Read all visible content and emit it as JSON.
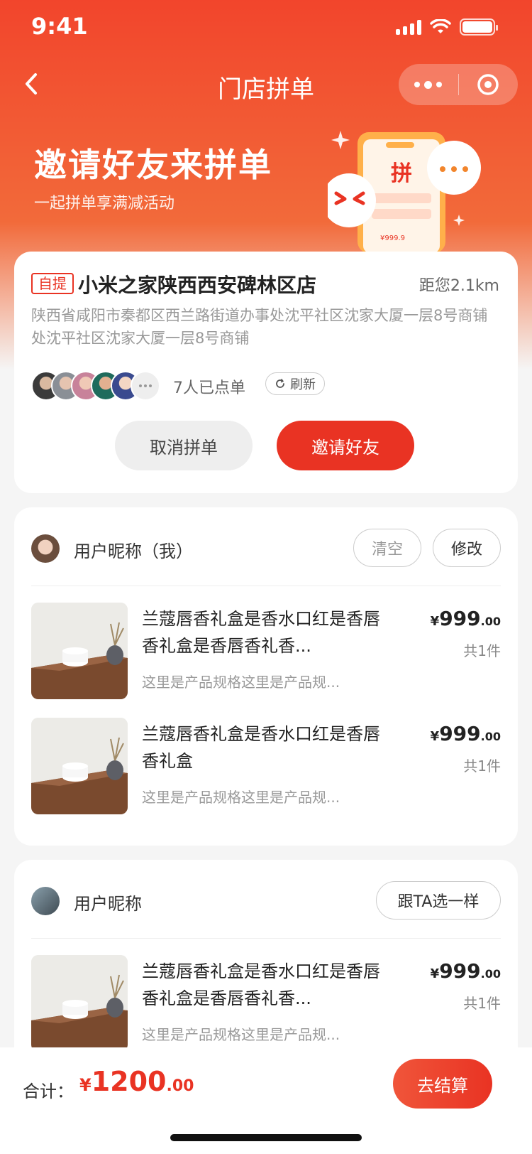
{
  "status_bar": {
    "time": "9:41"
  },
  "nav": {
    "title": "门店拼单"
  },
  "hero": {
    "title": "邀请好友来拼单",
    "subtitle": "一起拼单享满减活动",
    "badge_char": "拼",
    "badge_price": "¥999.9"
  },
  "store": {
    "tag": "自提",
    "name": "小米之家陕西西安碑林区店",
    "distance": "距您2.1km",
    "address": "陕西省咸阳市秦都区西兰路街道办事处沈平社区沈家大厦一层8号商铺处沈平社区沈家大厦一层8号商铺",
    "order_count": "7人已点单",
    "refresh_label": "刷新",
    "cancel_label": "取消拼单",
    "invite_label": "邀请好友"
  },
  "sections": [
    {
      "user_name": "用户昵称（我）",
      "clear_label": "清空",
      "edit_label": "修改",
      "products": [
        {
          "title": "兰蔻唇香礼盒是香水口红是香唇香礼盒是香唇香礼香...",
          "spec": "这里是产品规格这里是产品规...",
          "price_currency": "¥",
          "price_int": "999",
          "price_dec": ".00",
          "qty": "共1件"
        },
        {
          "title": "兰蔻唇香礼盒是香水口红是香唇香礼盒",
          "spec": "这里是产品规格这里是产品规...",
          "price_currency": "¥",
          "price_int": "999",
          "price_dec": ".00",
          "qty": "共1件"
        }
      ]
    },
    {
      "user_name": "用户昵称",
      "follow_label": "跟TA选一样",
      "products": [
        {
          "title": "兰蔻唇香礼盒是香水口红是香唇香礼盒是香唇香礼香...",
          "spec": "这里是产品规格这里是产品规...",
          "price_currency": "¥",
          "price_int": "999",
          "price_dec": ".00",
          "qty": "共1件"
        }
      ]
    }
  ],
  "bottom": {
    "total_label": "合计：",
    "currency": "¥",
    "total_int": "1200",
    "total_dec": ".00",
    "checkout_label": "去结算"
  },
  "colors": {
    "brand": "#e93323",
    "hero_top": "#f2452c",
    "hero_mid": "#f26a3a"
  }
}
